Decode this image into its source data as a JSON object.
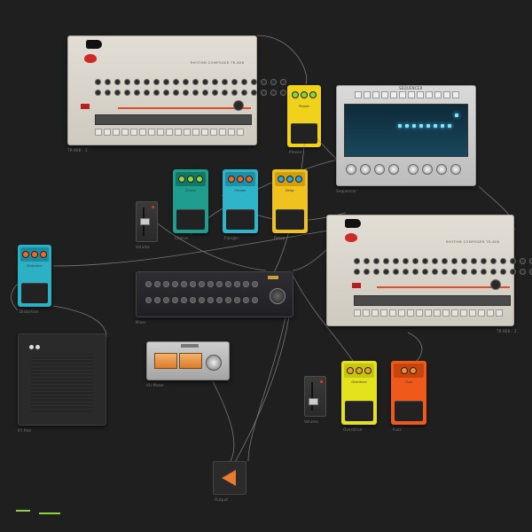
{
  "canvas": {
    "background": "#1f1f1f",
    "wire_color": "#8e8e8e"
  },
  "legend": {
    "color": "#8bd63c"
  },
  "devices": {
    "drum1": {
      "caption": "TR-808 - 1",
      "brand_text": "RHYTHM COMPOSER TR-808"
    },
    "pedal_top": {
      "caption": "Phaser",
      "label": "Phaser",
      "color": "#f0d21d",
      "knob_color": "#8bd43a"
    },
    "sequencer": {
      "caption": "Sequencer",
      "title": "SEQUENCER"
    },
    "pedals_mid": [
      {
        "caption": "Chorus",
        "label": "Chorus",
        "color": "#1f9e8e",
        "knob_color": "#8fd640"
      },
      {
        "caption": "Flanger",
        "label": "Flanger",
        "color": "#2eb5c9",
        "knob_color": "#ef6a2a"
      },
      {
        "caption": "Delay",
        "label": "Delay",
        "color": "#f0c21f",
        "knob_color": "#2aa6e8"
      }
    ],
    "fader1": {
      "caption": "Volume"
    },
    "drum2": {
      "caption": "TR-808 - 2",
      "brand_text": "RHYTHM COMPOSER TR-808"
    },
    "pedal_left": {
      "caption": "Distortion",
      "label": "Distortion",
      "color": "#2cb0c4",
      "knob_color": "#ef6a2a"
    },
    "mixer": {
      "caption": "Mixer"
    },
    "pad": {
      "caption": "XY Pad"
    },
    "vu": {
      "caption": "VU Meter"
    },
    "fader2": {
      "caption": "Volume"
    },
    "pedal_yellow": {
      "caption": "Overdrive",
      "label": "Overdrive",
      "color": "#e3e21d",
      "knob_color": "#e9a52a"
    },
    "pedal_orange": {
      "caption": "Fuzz",
      "label": "Fuzz",
      "color": "#ef5a1a",
      "knob_color": "#f18c3a"
    },
    "output": {
      "caption": "Output"
    }
  }
}
